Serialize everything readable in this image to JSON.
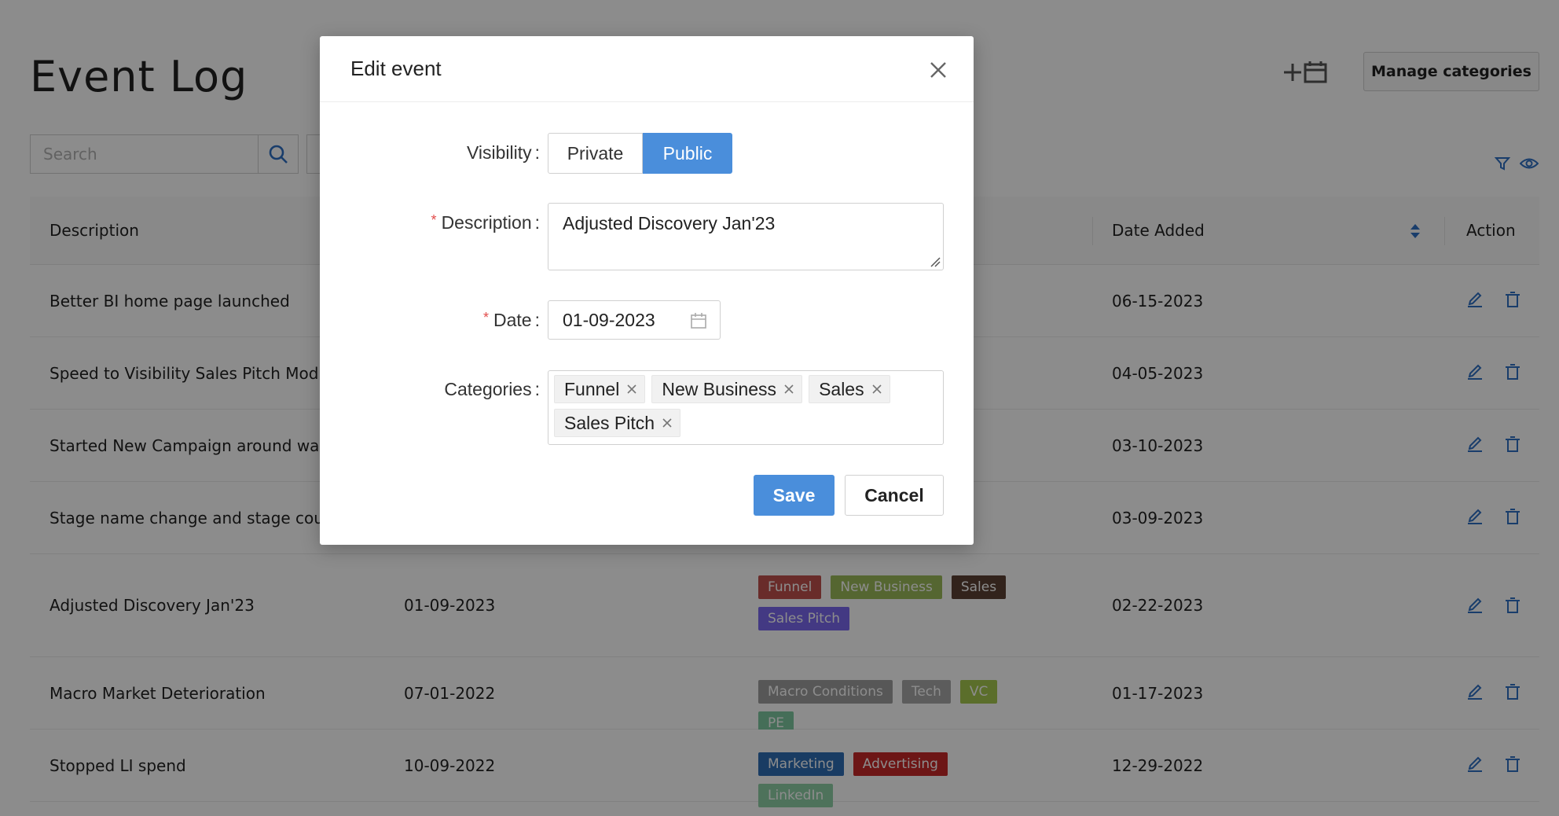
{
  "page": {
    "title": "Event Log",
    "manage_label": "Manage categories",
    "search_placeholder": "Search"
  },
  "table": {
    "headers": {
      "description": "Description",
      "date_added": "Date Added",
      "action": "Action"
    },
    "rows": [
      {
        "description": "Better BI home page launched",
        "date": "",
        "tags": [],
        "date_added": "06-15-2023"
      },
      {
        "description": "Speed to Visibility Sales Pitch Mod",
        "date": "",
        "tags": [],
        "date_added": "04-05-2023"
      },
      {
        "description": "Started New Campaign around waste",
        "date": "",
        "tags": [],
        "date_added": "03-10-2023"
      },
      {
        "description": "Stage name change and stage count c",
        "date": "",
        "tags": [],
        "date_added": "03-09-2023"
      },
      {
        "description": "Adjusted Discovery Jan'23",
        "date": "01-09-2023",
        "tags": [
          {
            "label": "Funnel",
            "color": "#c0504d"
          },
          {
            "label": "New Business",
            "color": "#9bbb59"
          },
          {
            "label": "Sales",
            "color": "#5c4033"
          },
          {
            "label": "Sales Pitch",
            "color": "#7b68ee"
          }
        ],
        "date_added": "02-22-2023"
      },
      {
        "description": "Macro Market Deterioration",
        "date": "07-01-2022",
        "tags": [
          {
            "label": "Macro Conditions",
            "color": "#9e9e9e"
          },
          {
            "label": "Tech",
            "color": "#a8a8a8"
          },
          {
            "label": "VC",
            "color": "#a6c84f"
          },
          {
            "label": "PE",
            "color": "#7fc9a0"
          }
        ],
        "date_added": "01-17-2023"
      },
      {
        "description": "Stopped LI spend",
        "date": "10-09-2022",
        "tags": [
          {
            "label": "Marketing",
            "color": "#2e6db4"
          },
          {
            "label": "Advertising",
            "color": "#c62828"
          },
          {
            "label": "LinkedIn",
            "color": "#8fcfa6"
          }
        ],
        "date_added": "12-29-2022"
      }
    ]
  },
  "modal": {
    "title": "Edit event",
    "visibility_label": "Visibility",
    "visibility_options": [
      "Private",
      "Public"
    ],
    "visibility_selected": "Public",
    "description_label": "Description",
    "description_value": "Adjusted Discovery Jan'23",
    "date_label": "Date",
    "date_value": "01-09-2023",
    "categories_label": "Categories",
    "categories": [
      "Funnel",
      "New Business",
      "Sales",
      "Sales Pitch"
    ],
    "save_label": "Save",
    "cancel_label": "Cancel"
  },
  "colors": {
    "primary": "#4a8edb",
    "required": "#e24c4b",
    "overlay": "rgba(0,0,0,0.45)"
  }
}
